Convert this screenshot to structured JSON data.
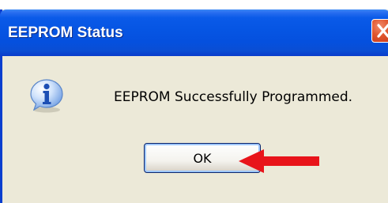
{
  "window": {
    "title": "EEPROM Status"
  },
  "dialog": {
    "icon": "info-icon",
    "message": "EEPROM Successfully Programmed.",
    "ok_label": "OK"
  },
  "annotation": {
    "arrow": "red-arrow-pointing-left",
    "color": "#e8141a"
  },
  "colors": {
    "titlebar": "#0655e3",
    "window_bg": "#ece9d8",
    "close": "#e0552d"
  }
}
